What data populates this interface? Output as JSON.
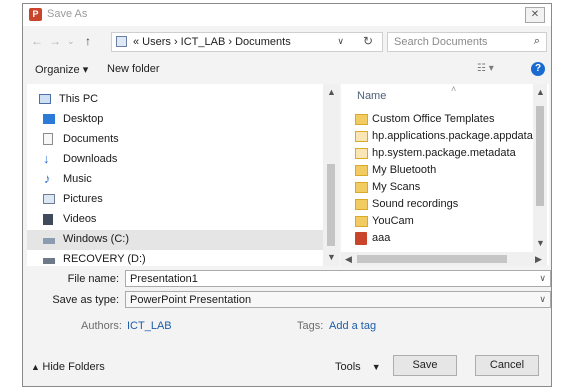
{
  "window": {
    "title": "Save As",
    "close_glyph": "✕",
    "app_icon": "powerpoint-icon"
  },
  "address": {
    "back_glyph": "←",
    "forward_glyph": "→",
    "recent_glyph": "⌄",
    "up_glyph": "↑",
    "path": "« Users › ICT_LAB › Documents",
    "refresh_glyph": "↻",
    "chevron_glyph": "∨"
  },
  "search": {
    "placeholder": "Search Documents",
    "icon_glyph": "⌕"
  },
  "toolbar": {
    "organize_label": "Organize ▾",
    "new_folder_label": "New folder",
    "view_glyph": "☷ ▾",
    "help_glyph": "?"
  },
  "nav_pane": {
    "items": [
      {
        "label": "This PC",
        "icon": "pc-icon"
      },
      {
        "label": "Desktop",
        "icon": "desktop-icon"
      },
      {
        "label": "Documents",
        "icon": "documents-icon"
      },
      {
        "label": "Downloads",
        "icon": "downloads-icon"
      },
      {
        "label": "Music",
        "icon": "music-icon"
      },
      {
        "label": "Pictures",
        "icon": "pictures-icon"
      },
      {
        "label": "Videos",
        "icon": "videos-icon"
      },
      {
        "label": "Windows (C:)",
        "icon": "drive-icon",
        "selected": true
      },
      {
        "label": "RECOVERY (D:)",
        "icon": "drive-icon"
      }
    ]
  },
  "file_pane": {
    "column_name": "Name",
    "items": [
      {
        "label": "Custom Office Templates",
        "type": "folder"
      },
      {
        "label": "hp.applications.package.appdata",
        "type": "folder"
      },
      {
        "label": "hp.system.package.metadata",
        "type": "folder"
      },
      {
        "label": "My Bluetooth",
        "type": "folder"
      },
      {
        "label": "My Scans",
        "type": "folder"
      },
      {
        "label": "Sound recordings",
        "type": "folder"
      },
      {
        "label": "YouCam",
        "type": "folder"
      },
      {
        "label": "aaa",
        "type": "pptx"
      }
    ]
  },
  "form": {
    "file_name_label": "File name:",
    "file_name_value": "Presentation1",
    "save_type_label": "Save as type:",
    "save_type_value": "PowerPoint Presentation",
    "authors_label": "Authors:",
    "authors_value": "ICT_LAB",
    "tags_label": "Tags:",
    "tags_value": "Add a tag"
  },
  "footer": {
    "hide_folders_label": "Hide Folders",
    "tools_label": "Tools",
    "save_label": "Save",
    "cancel_label": "Cancel"
  },
  "colors": {
    "accent": "#1a6bd1",
    "link": "#1e5dab",
    "selection": "#e5e5e5",
    "folder": "#f2cc63"
  }
}
